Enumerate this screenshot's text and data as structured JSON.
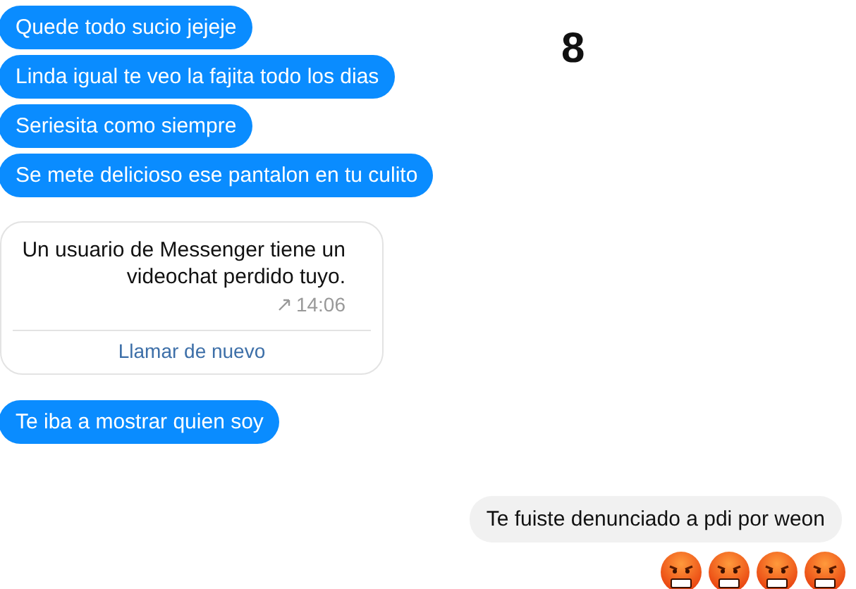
{
  "sticker": "8",
  "messages_top": [
    {
      "text": "Quede todo sucio jejeje"
    },
    {
      "text": "Linda igual te veo la fajita todo los dias"
    },
    {
      "text": "Seriesita como siempre"
    },
    {
      "text": "Se mete delicioso ese pantalon en tu culito"
    }
  ],
  "call_card": {
    "text": "Un usuario de Messenger tiene un videochat perdido tuyo.",
    "time": "14:06",
    "action": "Llamar de nuevo"
  },
  "messages_after": [
    {
      "text": "Te iba a mostrar quien soy"
    }
  ],
  "received": [
    {
      "text": "Te fuiste denunciado a pdi por weon"
    }
  ],
  "emojis": [
    {
      "kind": "angry"
    },
    {
      "kind": "angry"
    },
    {
      "kind": "angry"
    },
    {
      "kind": "angry"
    }
  ]
}
